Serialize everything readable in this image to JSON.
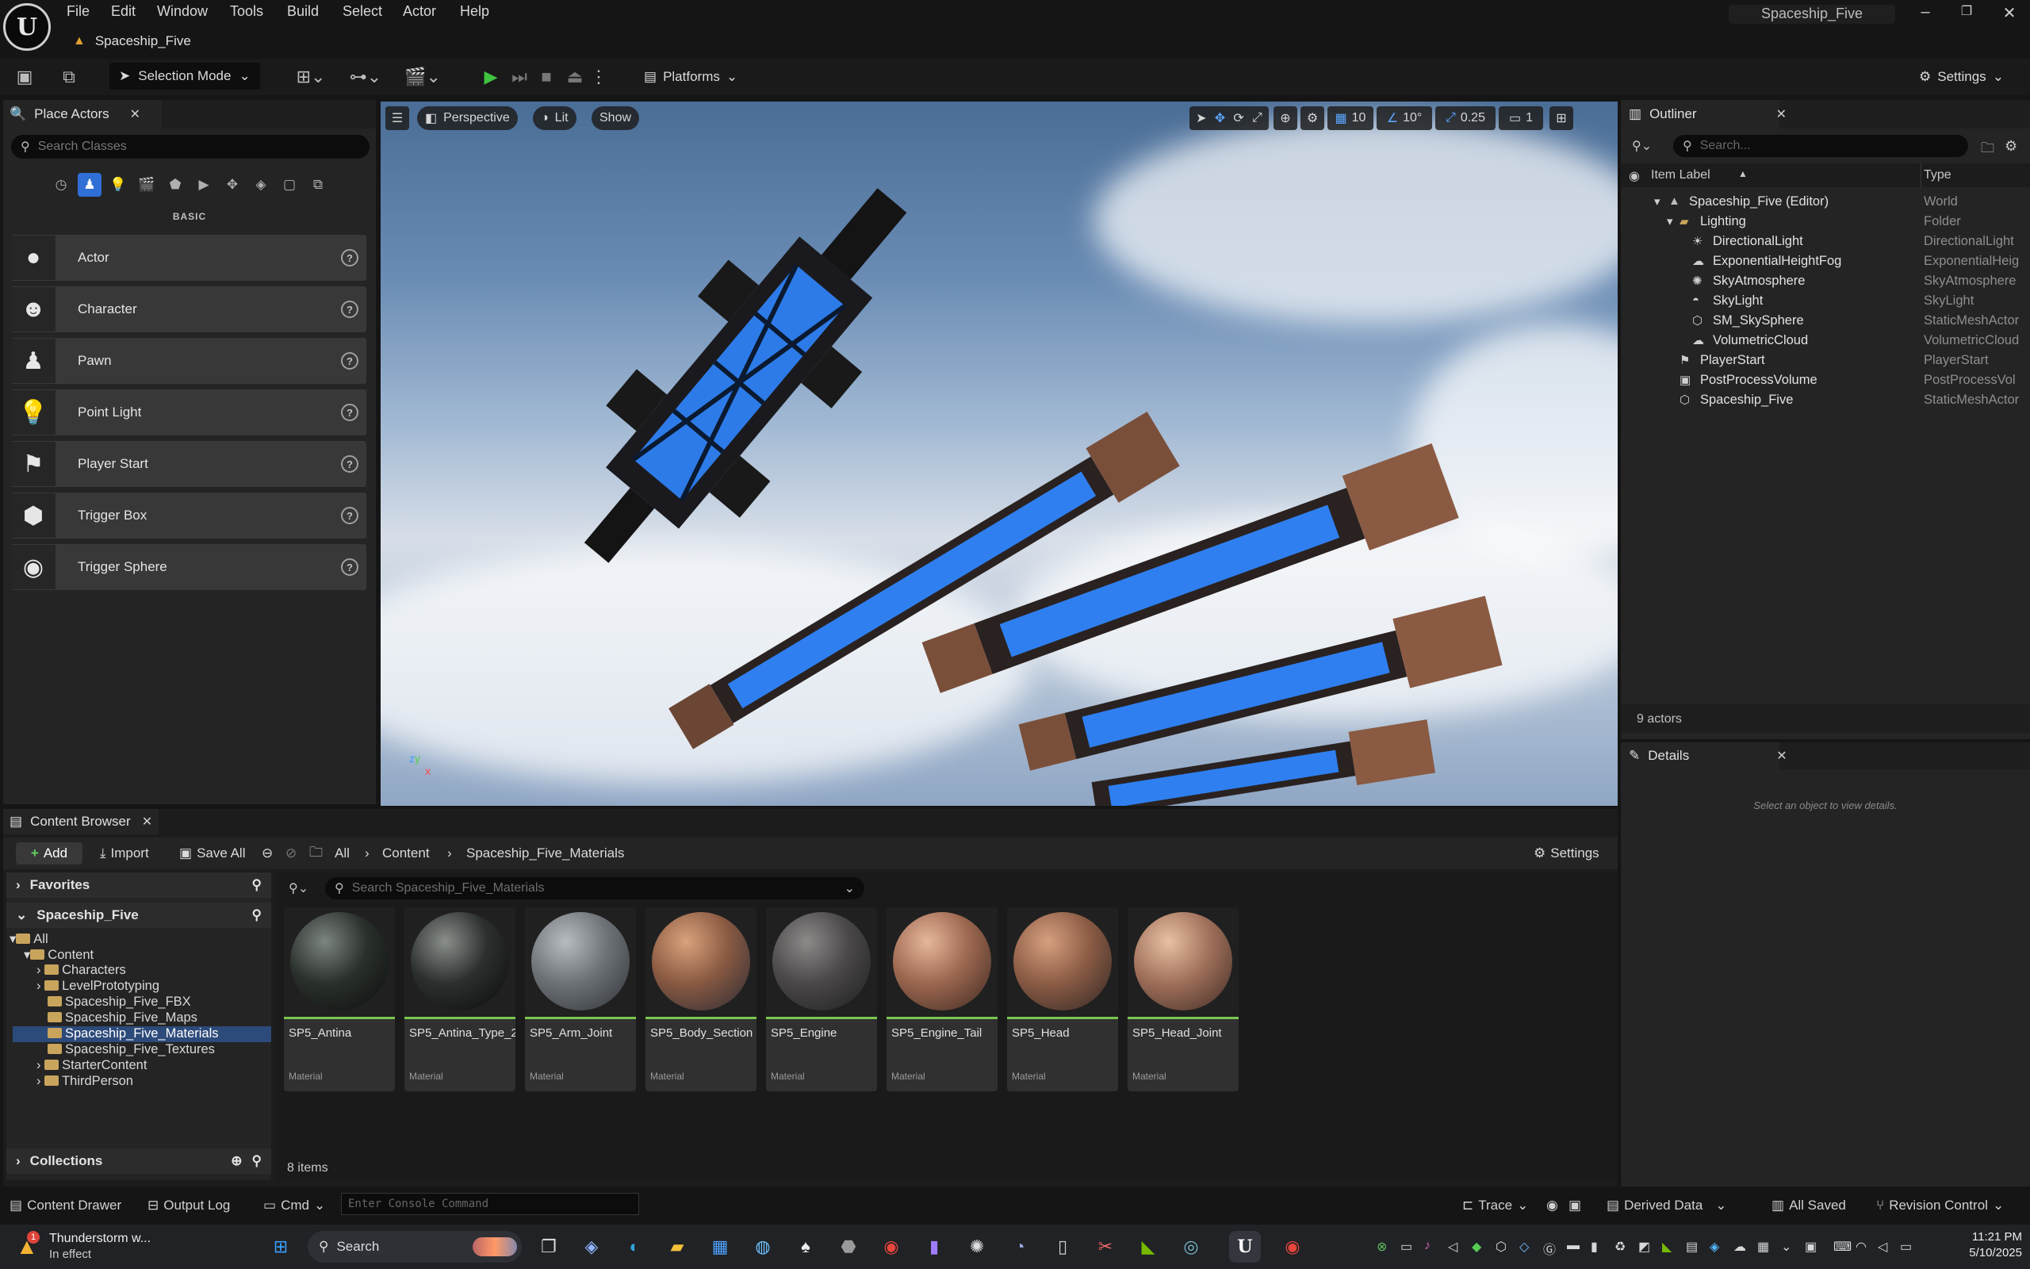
{
  "app": {
    "title": "Spaceship_Five",
    "doc_tab": "Spaceship_Five"
  },
  "menu": [
    "File",
    "Edit",
    "Window",
    "Tools",
    "Build",
    "Select",
    "Actor",
    "Help"
  ],
  "toolbar": {
    "selection_mode": "Selection Mode",
    "platforms": "Platforms",
    "settings": "Settings"
  },
  "place_actors": {
    "tab": "Place Actors",
    "search_placeholder": "Search Classes",
    "category": "BASIC",
    "items": [
      {
        "label": "Actor",
        "icon": "sphere-icon"
      },
      {
        "label": "Character",
        "icon": "character-icon"
      },
      {
        "label": "Pawn",
        "icon": "pawn-icon"
      },
      {
        "label": "Point Light",
        "icon": "point-light-icon"
      },
      {
        "label": "Player Start",
        "icon": "player-start-icon"
      },
      {
        "label": "Trigger Box",
        "icon": "trigger-box-icon"
      },
      {
        "label": "Trigger Sphere",
        "icon": "trigger-sphere-icon"
      }
    ]
  },
  "viewport": {
    "perspective": "Perspective",
    "lit": "Lit",
    "show": "Show",
    "grid_snap": "10",
    "rotation_snap": "10°",
    "scale_snap": "0.25",
    "camera_speed": "1"
  },
  "outliner": {
    "tab": "Outliner",
    "search_placeholder": "Search...",
    "col_label": "Item Label",
    "col_type": "Type",
    "rows": [
      {
        "label": "Spaceship_Five (Editor)",
        "type": "World"
      },
      {
        "label": "Lighting",
        "type": "Folder"
      },
      {
        "label": "DirectionalLight",
        "type": "DirectionalLight"
      },
      {
        "label": "ExponentialHeightFog",
        "type": "ExponentialHeig"
      },
      {
        "label": "SkyAtmosphere",
        "type": "SkyAtmosphere"
      },
      {
        "label": "SkyLight",
        "type": "SkyLight"
      },
      {
        "label": "SM_SkySphere",
        "type": "StaticMeshActor"
      },
      {
        "label": "VolumetricCloud",
        "type": "VolumetricCloud"
      },
      {
        "label": "PlayerStart",
        "type": "PlayerStart"
      },
      {
        "label": "PostProcessVolume",
        "type": "PostProcessVol"
      },
      {
        "label": "Spaceship_Five",
        "type": "StaticMeshActor"
      }
    ],
    "count": "9 actors"
  },
  "details": {
    "tab": "Details",
    "message": "Select an object to view details."
  },
  "content_browser": {
    "tab": "Content Browser",
    "add": "Add",
    "import": "Import",
    "save_all": "Save All",
    "path": [
      "All",
      "Content",
      "Spaceship_Five_Materials"
    ],
    "settings": "Settings",
    "favorites": "Favorites",
    "project": "Spaceship_Five",
    "tree": [
      {
        "label": "All"
      },
      {
        "label": "Content"
      },
      {
        "label": "Characters"
      },
      {
        "label": "LevelPrototyping"
      },
      {
        "label": "Spaceship_Five_FBX"
      },
      {
        "label": "Spaceship_Five_Maps"
      },
      {
        "label": "Spaceship_Five_Materials"
      },
      {
        "label": "Spaceship_Five_Textures"
      },
      {
        "label": "StarterContent"
      },
      {
        "label": "ThirdPerson"
      }
    ],
    "collections": "Collections",
    "filter_placeholder": "Search Spaceship_Five_Materials",
    "assets": [
      {
        "name": "SP5_Antina",
        "type": "Material"
      },
      {
        "name": "SP5_Antina_Type_2",
        "type": "Material"
      },
      {
        "name": "SP5_Arm_Joint",
        "type": "Material"
      },
      {
        "name": "SP5_Body_Section",
        "type": "Material"
      },
      {
        "name": "SP5_Engine",
        "type": "Material"
      },
      {
        "name": "SP5_Engine_Tail",
        "type": "Material"
      },
      {
        "name": "SP5_Head",
        "type": "Material"
      },
      {
        "name": "SP5_Head_Joint",
        "type": "Material"
      }
    ],
    "count": "8 items"
  },
  "statusbar": {
    "content_drawer": "Content Drawer",
    "output_log": "Output Log",
    "cmd": "Cmd",
    "console_placeholder": "Enter Console Command",
    "trace": "Trace",
    "derived_data": "Derived Data",
    "all_saved": "All Saved",
    "revision_control": "Revision Control"
  },
  "taskbar": {
    "weather_title": "Thunderstorm w...",
    "weather_sub": "In effect",
    "weather_badge": "1",
    "search": "Search",
    "time": "11:21 PM",
    "date": "5/10/2025"
  },
  "colors": {
    "accent": "#2f6fd6",
    "material_line": "#7ac74f",
    "folder": "#c9a45c",
    "play": "#3fc43f"
  }
}
